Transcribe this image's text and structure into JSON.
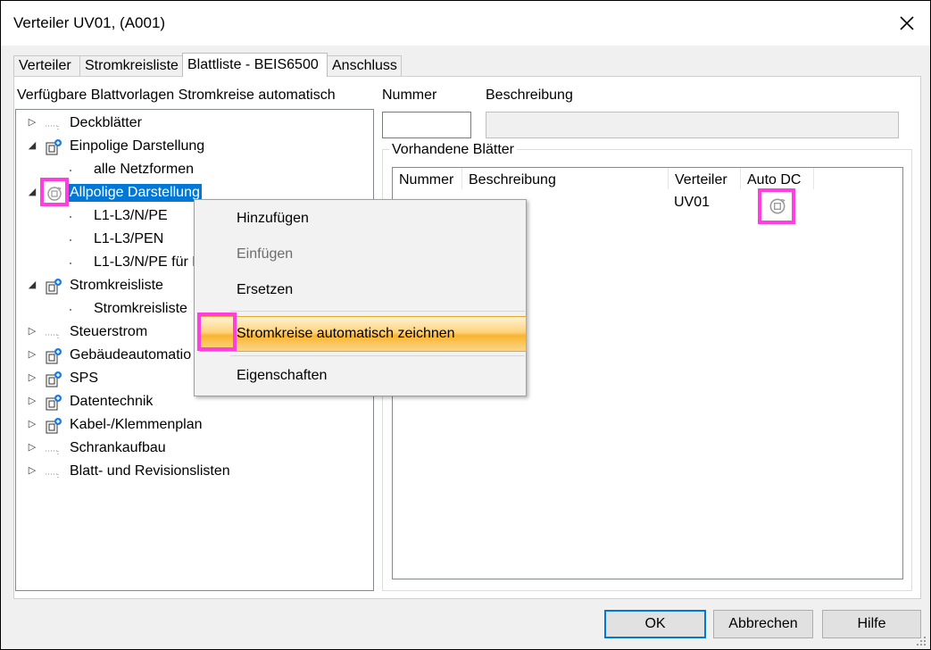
{
  "window": {
    "title": "Verteiler UV01,  (A001)"
  },
  "tabs": [
    {
      "label": "Verteiler"
    },
    {
      "label": "Stromkreisliste"
    },
    {
      "label": "Blattliste - BEIS6500"
    },
    {
      "label": "Anschluss"
    }
  ],
  "left": {
    "heading": "Verfügbare Blattvorlagen Stromkreise automatisch",
    "tree": [
      {
        "label": "Deckblätter"
      },
      {
        "label": "Einpolige Darstellung"
      },
      {
        "label": "alle Netzformen"
      },
      {
        "label": "Allpolige Darstellung"
      },
      {
        "label": "L1-L3/N/PE"
      },
      {
        "label": "L1-L3/PEN"
      },
      {
        "label": "L1-L3/N/PE für L"
      },
      {
        "label": "Stromkreisliste"
      },
      {
        "label": "Stromkreisliste"
      },
      {
        "label": "Steuerstrom"
      },
      {
        "label": "Gebäudeautomatio"
      },
      {
        "label": "SPS"
      },
      {
        "label": "Datentechnik"
      },
      {
        "label": "Kabel-/Klemmenplan"
      },
      {
        "label": "Schrankaufbau"
      },
      {
        "label": "Blatt- und Revisionslisten"
      }
    ]
  },
  "right": {
    "nummer_label": "Nummer",
    "beschreibung_label": "Beschreibung",
    "nummer_value": "",
    "beschreibung_value": "",
    "group_title": "Vorhandene Blätter",
    "columns": [
      "Nummer",
      "Beschreibung",
      "Verteiler",
      "Auto DC"
    ],
    "rows": [
      {
        "verteiler": "UV01"
      }
    ]
  },
  "context_menu": {
    "items": [
      {
        "label": "Hinzufügen"
      },
      {
        "label": "Einfügen"
      },
      {
        "label": "Ersetzen"
      },
      {
        "label": "Stromkreise automatisch zeichnen"
      },
      {
        "label": "Eigenschaften"
      }
    ]
  },
  "buttons": {
    "ok": "OK",
    "cancel": "Abbrechen",
    "help": "Hilfe"
  },
  "colors": {
    "selection": "#0078d7",
    "highlight_marker": "#ff3ee0",
    "menu_hover": "#f9b52f"
  },
  "icons": {
    "tree_page_icon": "page-collapsed-icon",
    "tree_folder_icon": "sheet-group-icon",
    "auto_dc_icon": "auto-draw-icon"
  }
}
